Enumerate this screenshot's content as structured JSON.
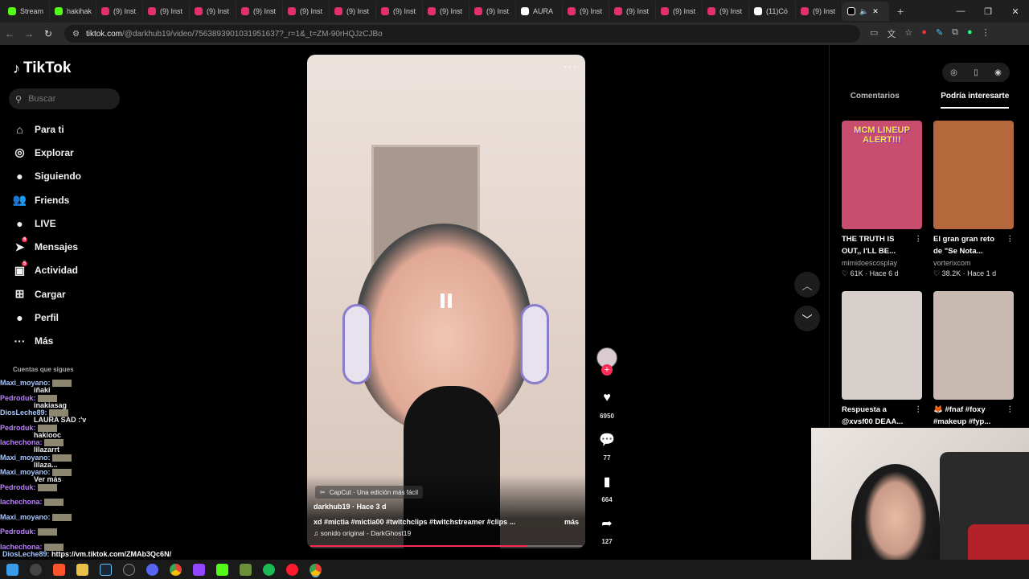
{
  "browser": {
    "tabs": [
      {
        "label": "Stream",
        "color": "#53fc18"
      },
      {
        "label": "hakihak",
        "color": "#53fc18"
      },
      {
        "label": "(9) Inst",
        "color": "#e1306c"
      },
      {
        "label": "(9) Inst",
        "color": "#e1306c"
      },
      {
        "label": "(9) Inst",
        "color": "#e1306c"
      },
      {
        "label": "(9) Inst",
        "color": "#e1306c"
      },
      {
        "label": "(9) Inst",
        "color": "#e1306c"
      },
      {
        "label": "(9) Inst",
        "color": "#e1306c"
      },
      {
        "label": "(9) Inst",
        "color": "#e1306c"
      },
      {
        "label": "(9) Inst",
        "color": "#e1306c"
      },
      {
        "label": "(9) Inst",
        "color": "#e1306c"
      },
      {
        "label": "AURA",
        "color": "#ffffff"
      },
      {
        "label": "(9) Inst",
        "color": "#e1306c"
      },
      {
        "label": "(9) Inst",
        "color": "#e1306c"
      },
      {
        "label": "(9) Inst",
        "color": "#e1306c"
      },
      {
        "label": "(9) Inst",
        "color": "#e1306c"
      },
      {
        "label": "(11)Có",
        "color": "#ffffff"
      },
      {
        "label": "(9) Inst",
        "color": "#e1306c"
      }
    ],
    "url_host": "tiktok.com",
    "url_path": "/@darkhub19/video/7563893901031951637?_r=1&_t=ZM-90rHQJzCJBo"
  },
  "sidebar": {
    "logo": "TikTok",
    "search_placeholder": "Buscar",
    "items": [
      {
        "label": "Para ti",
        "icon": "⌂"
      },
      {
        "label": "Explorar",
        "icon": "◎"
      },
      {
        "label": "Siguiendo",
        "icon": "●"
      },
      {
        "label": "Friends",
        "icon": "👥"
      },
      {
        "label": "LIVE",
        "icon": "●"
      },
      {
        "label": "Mensajes",
        "icon": "➤",
        "badge": "6"
      },
      {
        "label": "Actividad",
        "icon": "▣",
        "badge": "5"
      },
      {
        "label": "Cargar",
        "icon": "⊞"
      },
      {
        "label": "Perfil",
        "icon": "●"
      },
      {
        "label": "Más",
        "icon": "···"
      }
    ],
    "following_header": "Cuentas que sigues",
    "following": [
      "iñaki",
      "inakiasag",
      "LAURA SAD :'v",
      "hakiooc",
      "lilazarrt",
      "lilaza...",
      "Ver más"
    ]
  },
  "chat": {
    "lines": [
      {
        "user": "Maxi_moyano:",
        "color": "#a7c7ff"
      },
      {
        "user": "Pedroduk:",
        "color": "#b980ff"
      },
      {
        "user": "DiosLeche89:",
        "color": "#a7c7ff"
      },
      {
        "user": "Pedroduk:",
        "color": "#b980ff"
      },
      {
        "user": "lachechona:",
        "color": "#b980ff"
      },
      {
        "user": "Maxi_moyano:",
        "color": "#a7c7ff"
      },
      {
        "user": "Maxi_moyano:",
        "color": "#a7c7ff"
      },
      {
        "user": "Pedroduk:",
        "color": "#b980ff"
      },
      {
        "user": "lachechona:",
        "color": "#b980ff"
      },
      {
        "user": "Maxi_moyano:",
        "color": "#a7c7ff"
      },
      {
        "user": "Pedroduk:",
        "color": "#b980ff"
      },
      {
        "user": "lachechona:",
        "color": "#b980ff"
      }
    ],
    "last_user": "DiosLeche89:",
    "last_message": "https://vm.tiktok.com/ZMAb3Qc6N/"
  },
  "video": {
    "capcut": "CapCut · Una edición más fácil",
    "author": "darkhub19 · Hace 3 d",
    "description": "xd #mictia #mictia00 #twitchclips #twitchstreamer #clips ...",
    "more": "más",
    "sound": "♫ sonido original - DarkGhost19",
    "progress": 0.8
  },
  "actions": {
    "likes": "6950",
    "comments": "77",
    "saves": "664",
    "shares": "127"
  },
  "right_panel": {
    "tabs": [
      "Comentarios",
      "Podría interesarte"
    ],
    "active_tab": "Podría interesarte",
    "cards": [
      {
        "title1": "THE TRUTH IS",
        "title2": "OUT,, I'LL BE...",
        "author": "mimidoescosplay",
        "meta": "♡ 61K · Hace 6 d",
        "overlay": "MCM LINEUP ALERT!!!",
        "bg": "#c94d6e"
      },
      {
        "title1": "El gran gran reto",
        "title2": "de \"Se Nota...",
        "author": "vorterixcom",
        "meta": "♡ 38.2K · Hace 1 d",
        "overlay": "",
        "bg": "#b4683b"
      },
      {
        "title1": "Respuesta a",
        "title2": "@xvsf00 DEAA...",
        "author": "",
        "meta": "",
        "overlay": "",
        "bg": "#d7cfcc"
      },
      {
        "title1": "🦊 #fnaf #foxy",
        "title2": "#makeup #fyp...",
        "author": "",
        "meta": "",
        "overlay": "",
        "bg": "#c8b9b1"
      }
    ]
  }
}
